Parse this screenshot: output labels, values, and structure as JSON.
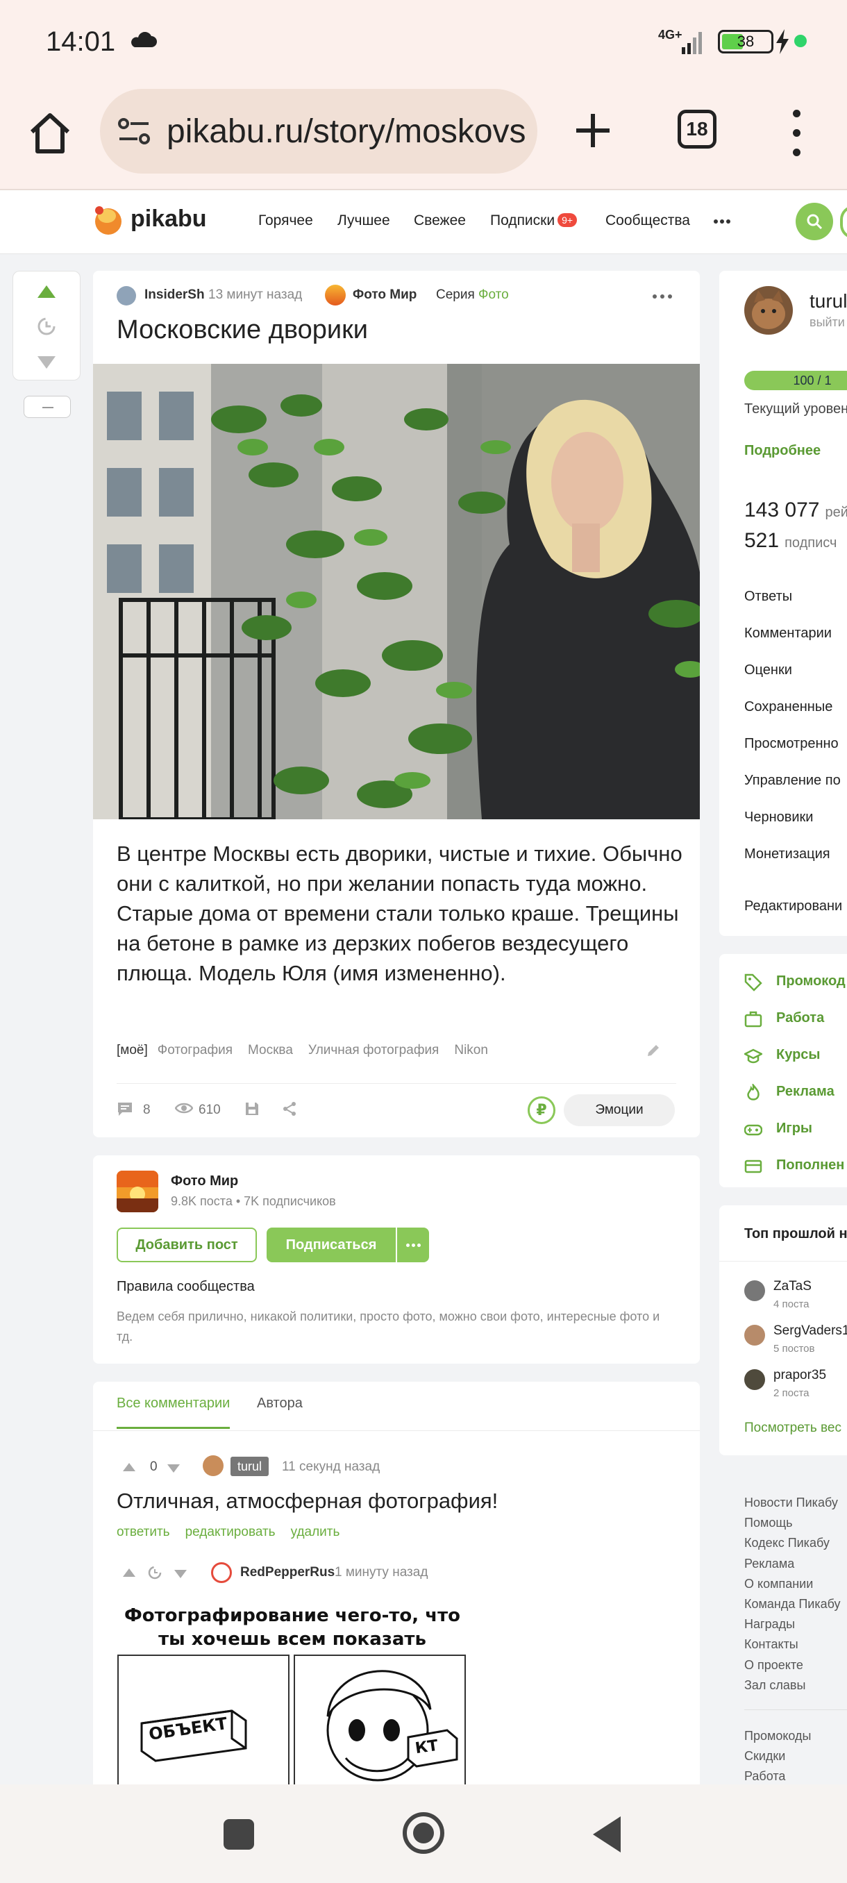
{
  "status": {
    "time": "14:01",
    "network": "4G+",
    "battery": "38"
  },
  "browser": {
    "url": "pikabu.ru/story/moskovs",
    "tab_count": "18"
  },
  "header": {
    "logo": "pikabu",
    "nav": [
      "Горячее",
      "Лучшее",
      "Свежее",
      "Подписки",
      "Сообщества"
    ],
    "subs_badge": "9+"
  },
  "story": {
    "author": "InsiderSh",
    "time": "13 минут назад",
    "community": "Фото Мир",
    "series_label": "Серия",
    "series_name": "Фото",
    "title": "Московские дворики",
    "text": "В центре Москвы есть дворики, чистые и тихие. Обычно они с калиткой, но при желании попасть туда можно. Старые дома от времени стали только краше. Трещины на бетоне в рамке из дерзких побегов вездесущего плюща. Модель Юля (имя измененно).",
    "tags": [
      "[моё]",
      "Фотография",
      "Москва",
      "Уличная фотография",
      "Nikon"
    ],
    "comments_count": "8",
    "views": "610",
    "emotions_label": "Эмоции"
  },
  "community": {
    "name": "Фото Мир",
    "posts": "9.8K поста",
    "subscribers": "7K подписчиков",
    "add_post": "Добавить пост",
    "subscribe": "Подписаться",
    "rules_title": "Правила сообщества",
    "rules_text": "Ведем себя прилично, никакой политики, просто фото, можно свои фото, интересные фото и тд."
  },
  "comments": {
    "tab_all": "Все комментарии",
    "tab_author": "Автора",
    "first": {
      "rating": "0",
      "user": "turul",
      "time": "11 секунд назад",
      "text": "Отличная, атмосферная фотография!",
      "actions": [
        "ответить",
        "редактировать",
        "удалить"
      ]
    },
    "second": {
      "user": "RedPepperRus",
      "time": "1 минуту назад",
      "meme_title": "Фотографирование чего-то, что ты хочешь всем показать",
      "meme_label_left": "ОБЪЕКТ",
      "meme_label_right": "КТ"
    }
  },
  "sidebar": {
    "user": "turul",
    "logout": "выйти",
    "level": "100 / 1",
    "level_label": "Текущий уровен",
    "more": "Подробнее",
    "rating_num": "143 077",
    "rating_label": "рей",
    "subs_num": "521",
    "subs_label": "подписч",
    "links": [
      "Ответы",
      "Комментарии",
      "Оценки",
      "Сохраненные",
      "Просмотренно",
      "Управление по",
      "Черновики",
      "Монетизация",
      "Редактировани"
    ],
    "promo": [
      "Промокод",
      "Работа",
      "Курсы",
      "Реклама",
      "Игры",
      "Пополнен"
    ],
    "top_title": "Топ прошлой не",
    "top_users": [
      {
        "name": "ZaTaS",
        "count": "4 поста"
      },
      {
        "name": "SergVaders1",
        "count": "5 постов"
      },
      {
        "name": "prapor35",
        "count": "2 поста"
      }
    ],
    "see_all": "Посмотреть вес",
    "footer": [
      "Новости Пикабу",
      "Помощь",
      "Кодекс Пикабу",
      "Реклама",
      "О компании",
      "Команда Пикабу",
      "Награды",
      "Контакты",
      "О проекте",
      "Зал славы"
    ],
    "footer2": [
      "Промокоды",
      "Скидки",
      "Работа"
    ]
  }
}
